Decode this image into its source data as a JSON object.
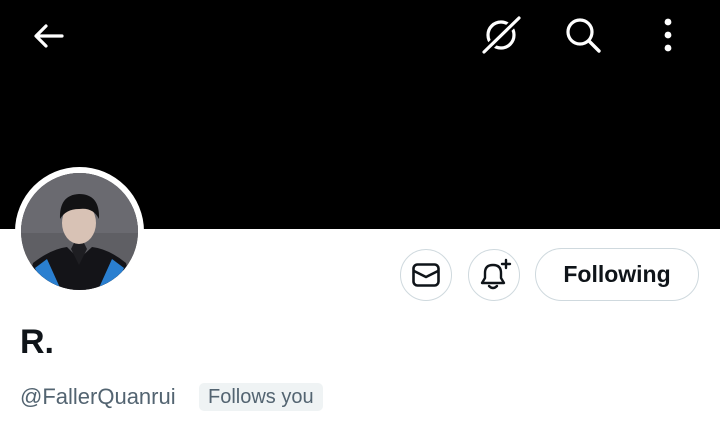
{
  "profile": {
    "display_name": "R.",
    "handle": "@FallerQuanrui",
    "follows_you_label": "Follows you",
    "following_label": "Following"
  },
  "icons": {
    "back": "back-arrow-icon",
    "grok": "grok-icon",
    "search": "search-icon",
    "more": "more-vertical-icon",
    "message": "envelope-icon",
    "notify": "bell-plus-icon"
  },
  "colors": {
    "banner": "#000000",
    "text_primary": "#0f1419",
    "text_secondary": "#536471",
    "border": "#cfd9de",
    "badge_bg": "#eff3f4"
  }
}
